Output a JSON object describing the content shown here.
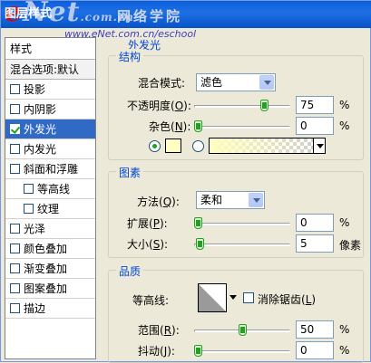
{
  "window": {
    "title": "图层样式",
    "watermark": {
      "logo_e": "e",
      "logo_rest": "Net",
      "logo_suffix": ".com.cn",
      "subtitle": "网络学院",
      "url": "www.eNet.com.cn/eschool"
    }
  },
  "left_pane": {
    "header": "样式",
    "blend_options": "混合选项:默认",
    "items": [
      {
        "label": "投影",
        "checked": false,
        "selected": false,
        "indent": false
      },
      {
        "label": "内阴影",
        "checked": false,
        "selected": false,
        "indent": false
      },
      {
        "label": "外发光",
        "checked": true,
        "selected": true,
        "indent": false
      },
      {
        "label": "内发光",
        "checked": false,
        "selected": false,
        "indent": false
      },
      {
        "label": "斜面和浮雕",
        "checked": false,
        "selected": false,
        "indent": false
      },
      {
        "label": "等高线",
        "checked": false,
        "selected": false,
        "indent": true
      },
      {
        "label": "纹理",
        "checked": false,
        "selected": false,
        "indent": true
      },
      {
        "label": "光泽",
        "checked": false,
        "selected": false,
        "indent": false
      },
      {
        "label": "颜色叠加",
        "checked": false,
        "selected": false,
        "indent": false
      },
      {
        "label": "渐变叠加",
        "checked": false,
        "selected": false,
        "indent": false
      },
      {
        "label": "图案叠加",
        "checked": false,
        "selected": false,
        "indent": false
      },
      {
        "label": "描边",
        "checked": false,
        "selected": false,
        "indent": false
      }
    ]
  },
  "panel": {
    "title": "外发光",
    "structure": {
      "title": "结构",
      "blend_mode": {
        "label": "混合模式",
        "label_suffix": ":",
        "value": "滤色"
      },
      "opacity": {
        "label": "不透明度(",
        "key": "O",
        "label_end": "):",
        "value": "75",
        "unit": "%",
        "fraction": 0.75
      },
      "noise": {
        "label": "杂色(",
        "key": "N",
        "label_end": "):",
        "value": "0",
        "unit": "%",
        "fraction": 0.0
      },
      "color_swatch": "#fffdbf"
    },
    "elements": {
      "title": "图素",
      "method": {
        "label": "方法(",
        "key": "Q",
        "label_end": "):",
        "value": "柔和"
      },
      "spread": {
        "label": "扩展(",
        "key": "P",
        "label_end": "):",
        "value": "0",
        "unit": "%",
        "fraction": 0.0
      },
      "size": {
        "label": "大小(",
        "key": "S",
        "label_end": "):",
        "value": "5",
        "unit": "像素",
        "fraction": 0.02
      }
    },
    "quality": {
      "title": "品质",
      "contour": {
        "label": "等高线:"
      },
      "anti_alias": {
        "label": "消除锯齿(",
        "key": "L",
        "label_end": ")",
        "checked": false
      },
      "range": {
        "label": "范围(",
        "key": "R",
        "label_end": "):",
        "value": "50",
        "unit": "%",
        "fraction": 0.5
      },
      "jitter": {
        "label": "抖动(",
        "key": "J",
        "label_end": "):",
        "value": "0",
        "unit": "%",
        "fraction": 0.0
      }
    }
  }
}
